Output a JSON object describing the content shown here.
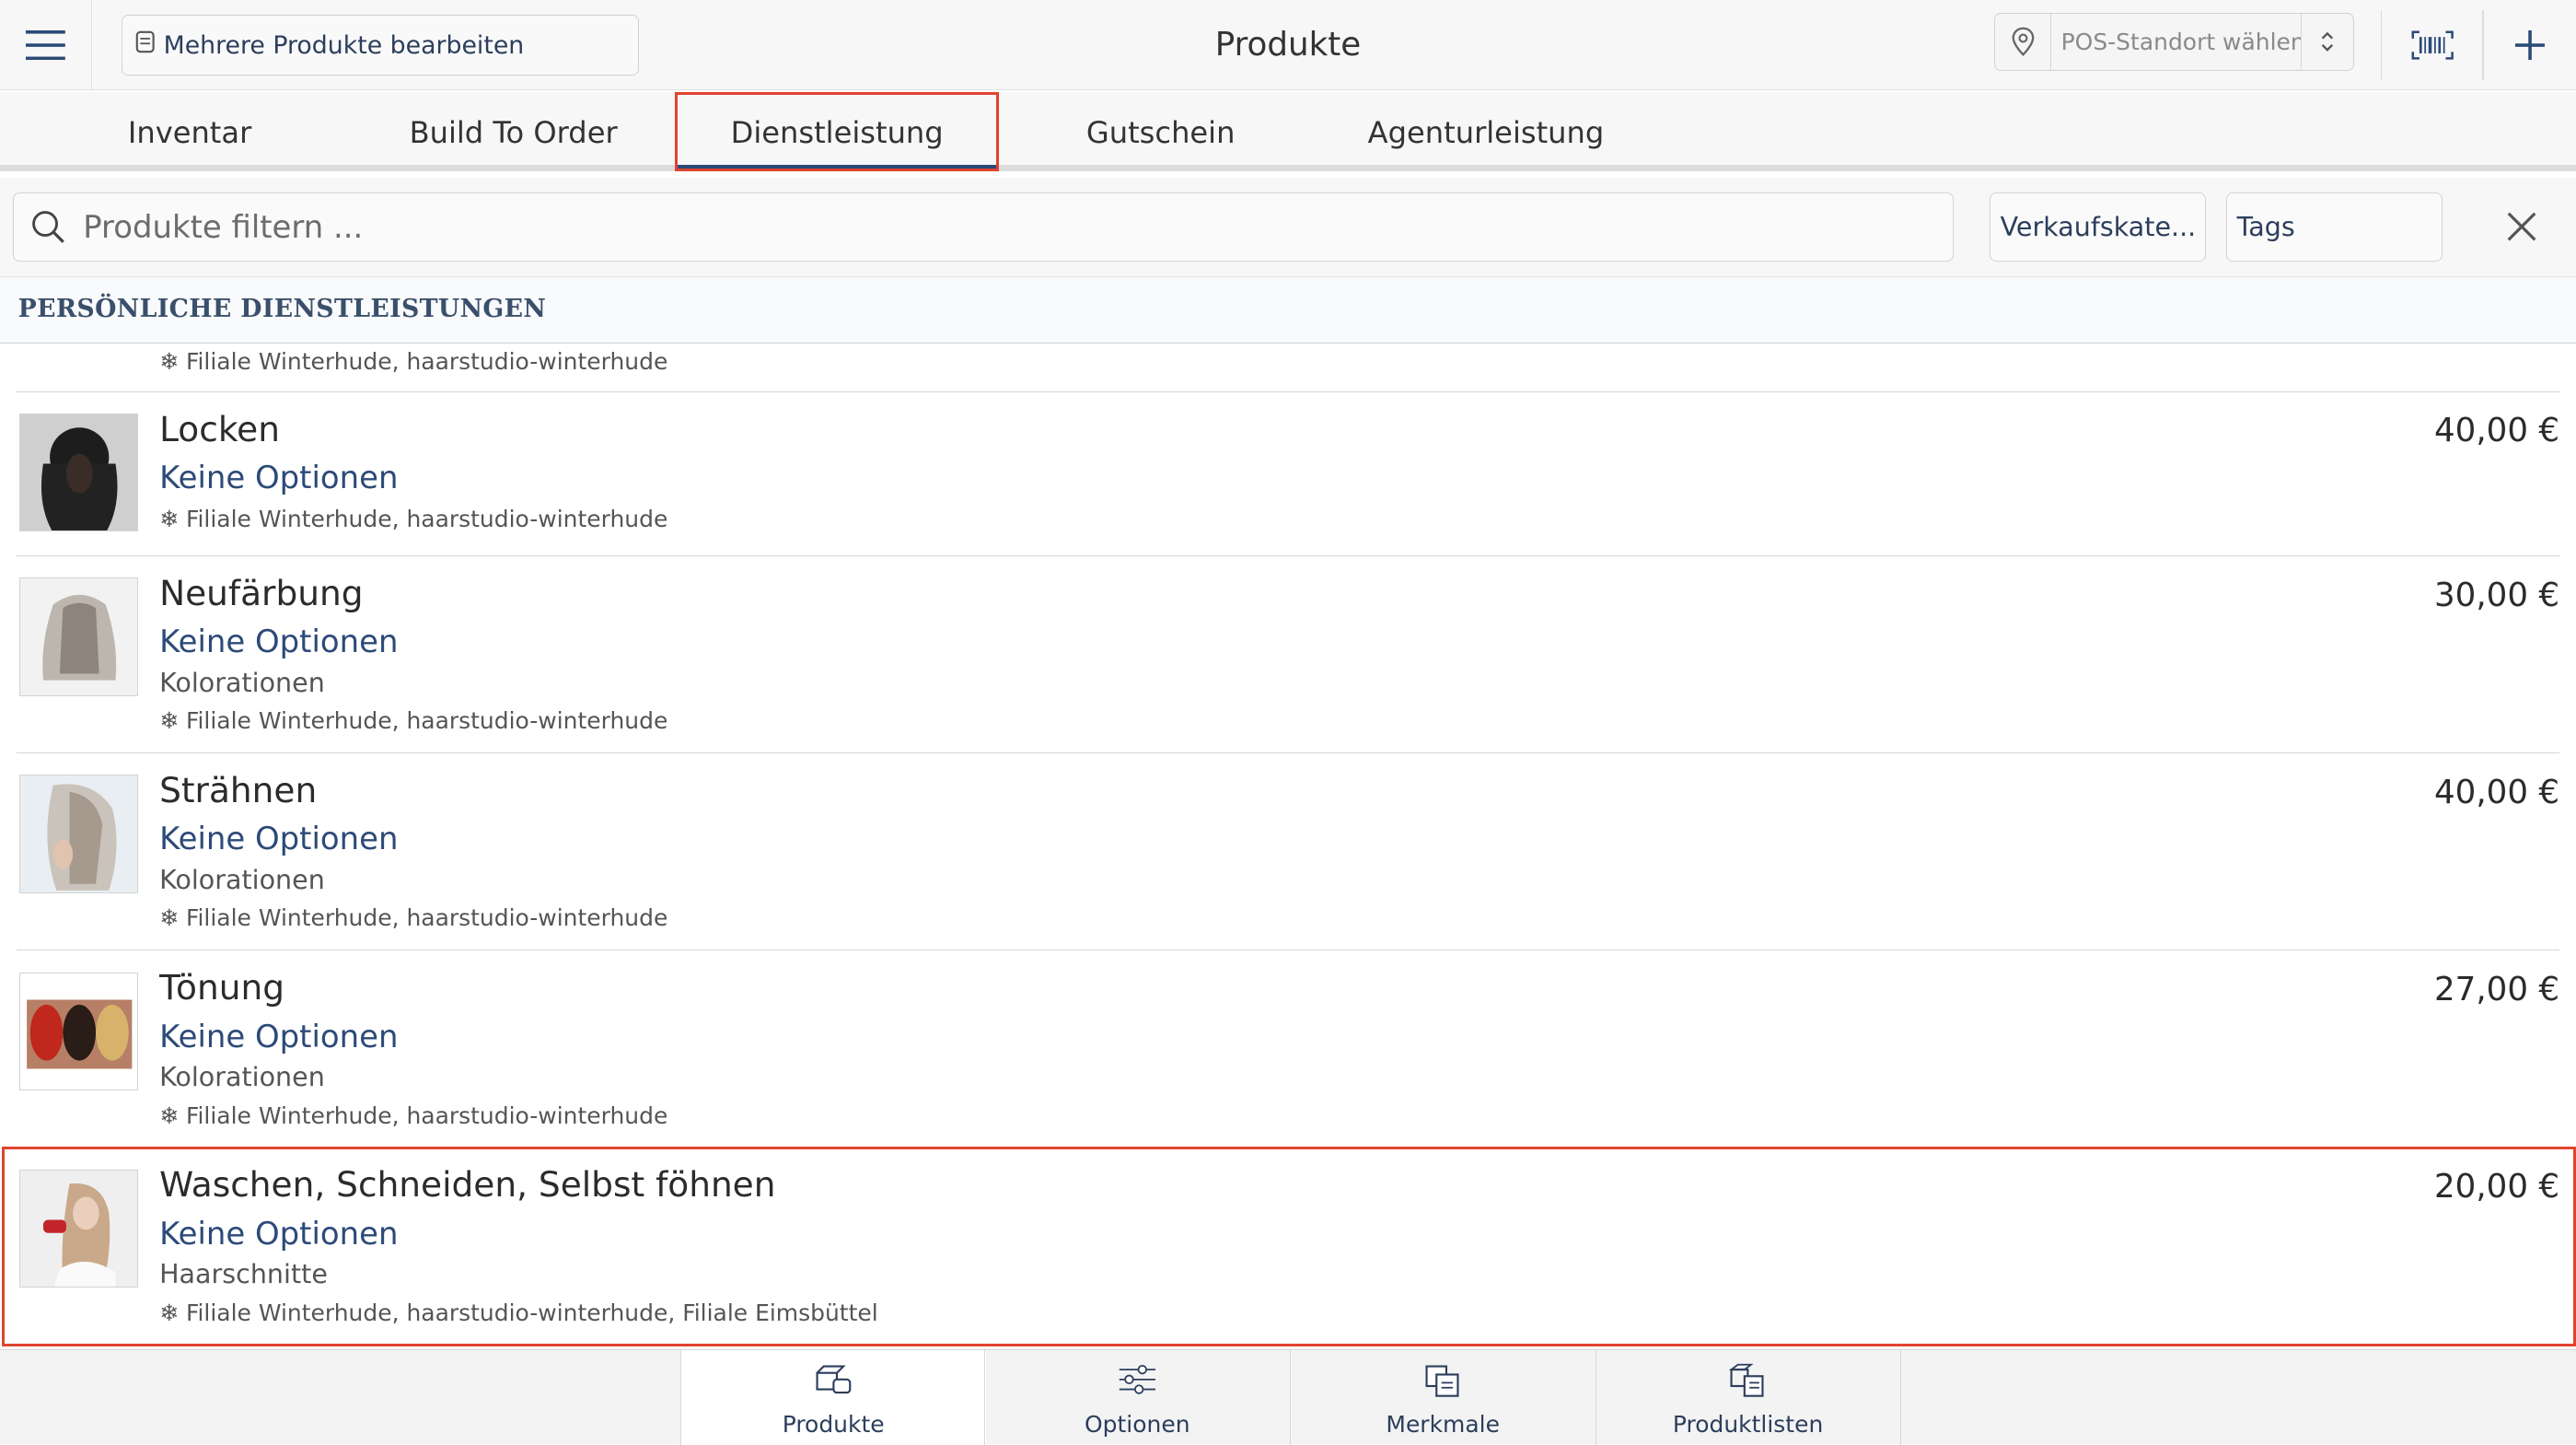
{
  "header": {
    "title": "Produkte",
    "bulk_edit_label": "Mehrere Produkte bearbeiten",
    "pos_placeholder": "POS-Standort wählen..."
  },
  "tabs": [
    {
      "label": "Inventar",
      "active": false
    },
    {
      "label": "Build To Order",
      "active": false
    },
    {
      "label": "Dienstleistung",
      "active": true
    },
    {
      "label": "Gutschein",
      "active": false
    },
    {
      "label": "Agenturleistung",
      "active": false
    }
  ],
  "filters": {
    "search_placeholder": "Produkte filtern ...",
    "category_label": "Verkaufskate...",
    "tags_label": "Tags"
  },
  "section_title": "PERSÖNLICHE DIENSTLEISTUNGEN",
  "partial_row_locations": "Filiale Winterhude, haarstudio-winterhude",
  "products": [
    {
      "name": "Locken",
      "options": "Keine Optionen",
      "category": "",
      "locations": "Filiale Winterhude, haarstudio-winterhude",
      "price": "40,00 €"
    },
    {
      "name": "Neufärbung",
      "options": "Keine Optionen",
      "category": "Kolorationen",
      "locations": "Filiale Winterhude, haarstudio-winterhude",
      "price": "30,00 €"
    },
    {
      "name": "Strähnen",
      "options": "Keine Optionen",
      "category": "Kolorationen",
      "locations": "Filiale Winterhude, haarstudio-winterhude",
      "price": "40,00 €"
    },
    {
      "name": "Tönung",
      "options": "Keine Optionen",
      "category": "Kolorationen",
      "locations": "Filiale Winterhude, haarstudio-winterhude",
      "price": "27,00 €"
    },
    {
      "name": "Waschen, Schneiden, Selbst föhnen",
      "options": "Keine Optionen",
      "category": "Haarschnitte",
      "locations": "Filiale Winterhude, haarstudio-winterhude, Filiale Eimsbüttel",
      "price": "20,00 €"
    }
  ],
  "bottom_nav": [
    {
      "label": "Produkte",
      "active": true
    },
    {
      "label": "Optionen",
      "active": false
    },
    {
      "label": "Merkmale",
      "active": false
    },
    {
      "label": "Produktlisten",
      "active": false
    }
  ],
  "colors": {
    "accent": "#2c4a78",
    "highlight": "#e0442f"
  }
}
